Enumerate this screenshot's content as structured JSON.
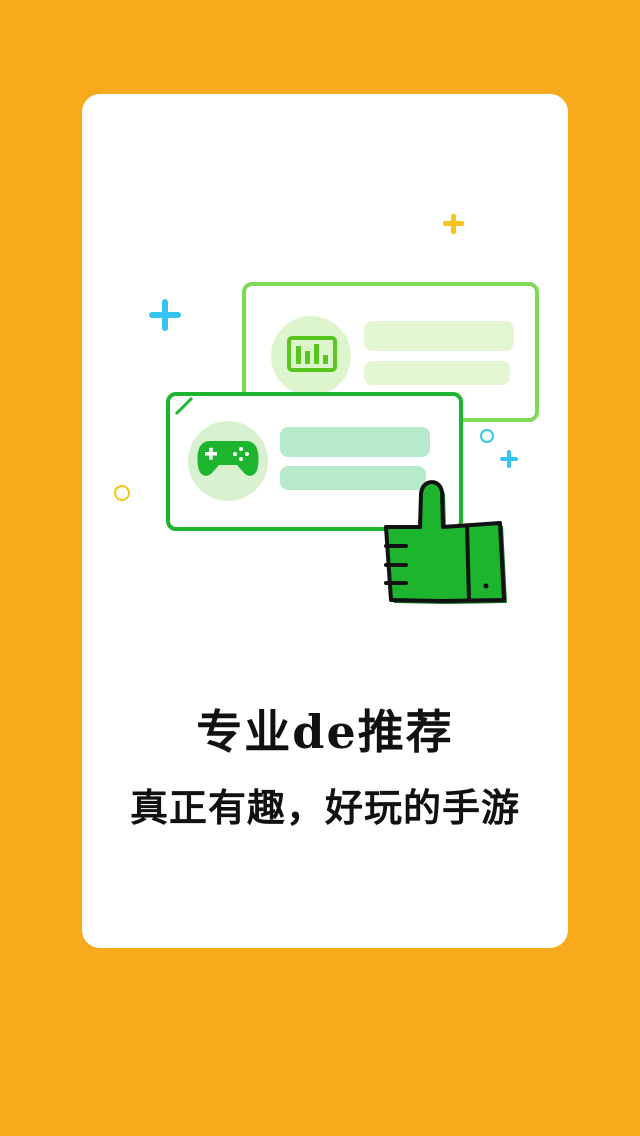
{
  "splash": {
    "title": "专业de推荐",
    "subtitle": "真正有趣，好玩的手游"
  },
  "colors": {
    "background": "#F6AA1C",
    "card": "#FFFFFF",
    "accent_green": "#1DB52E",
    "light_green": "#7ED957",
    "sparkle_blue": "#36C5F0",
    "sparkle_yellow": "#F6C21C"
  },
  "icons": {
    "chart": "chart-icon",
    "gamepad": "gamepad-icon",
    "thumbs_up": "thumbs-up-icon"
  }
}
